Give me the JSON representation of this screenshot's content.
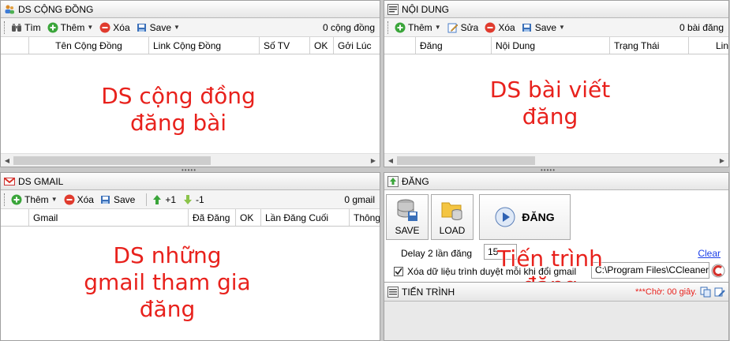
{
  "community": {
    "title": "DS CỘNG ĐỒNG",
    "toolbar": {
      "find": "Tìm",
      "add": "Thêm",
      "delete": "Xóa",
      "save": "Save",
      "count": "0 cộng đồng"
    },
    "columns": [
      "Tên Cộng Đồng",
      "Link Cộng Đồng",
      "Số TV",
      "OK",
      "Gởi Lúc"
    ],
    "annotation": [
      "DS cộng đồng",
      "đăng bài"
    ]
  },
  "content": {
    "title": "NỘI DUNG",
    "toolbar": {
      "add": "Thêm",
      "edit": "Sửa",
      "delete": "Xóa",
      "save": "Save",
      "count": "0 bài đăng"
    },
    "columns": [
      "Đăng",
      "Nội Dung",
      "Trạng Thái",
      "Lin"
    ],
    "annotation": [
      "DS bài viết",
      "đăng"
    ]
  },
  "gmail": {
    "title": "DS GMAIL",
    "toolbar": {
      "add": "Thêm",
      "delete": "Xóa",
      "save": "Save",
      "plus": "+1",
      "minus": "-1",
      "count": "0 gmail"
    },
    "columns": [
      "Gmail",
      "Đã Đăng",
      "OK",
      "Lần Đăng Cuối",
      "Thông"
    ],
    "annotation": [
      "DS những",
      "gmail tham gia",
      "đăng"
    ]
  },
  "post": {
    "title": "ĐĂNG",
    "save_label": "SAVE",
    "load_label": "LOAD",
    "post_label": "ĐĂNG",
    "delay_label": "Delay 2 lần đăng",
    "delay_value": "15",
    "clear_label": "Clear",
    "clear_browser_label": "Xóa dữ liệu trình duyệt mỗi khi đổi gmail",
    "ccleaner_path": "C:\\Program Files\\CCleaner\\",
    "annotation": [
      "Tiến trình",
      "đăng"
    ]
  },
  "progress": {
    "title": "TIẾN TRÌNH",
    "status": "***Chờ: 00 giây."
  },
  "colors": {
    "annotation": "#e8211c",
    "status": "#e8211c",
    "link": "#1a3ee8"
  }
}
